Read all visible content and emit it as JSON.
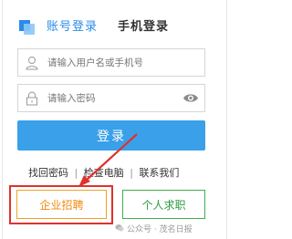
{
  "tabs": {
    "account_login": "账号登录",
    "phone_login": "手机登录"
  },
  "inputs": {
    "username_placeholder": "请输入用户名或手机号",
    "password_placeholder": "请输入密码"
  },
  "login_button": "登录",
  "links": {
    "forgot_password": "找回密码",
    "separator": "|",
    "check_computer": "检查电脑",
    "contact_us": "联系我们"
  },
  "bottom_buttons": {
    "business_recruit": "企业招聘",
    "personal_job": "个人求职"
  },
  "watermark": "公众号 · 茂名日报",
  "colors": {
    "accent_blue": "#2b8be8",
    "login_button": "#3aa0ea",
    "business_orange": "#f08a10",
    "personal_green": "#2e9b3e",
    "highlight_red": "#e0312d"
  },
  "icons": {
    "logo": "logo-icon",
    "user": "user-icon",
    "lock": "lock-icon",
    "eye": "eye-icon",
    "wechat": "wechat-icon"
  }
}
